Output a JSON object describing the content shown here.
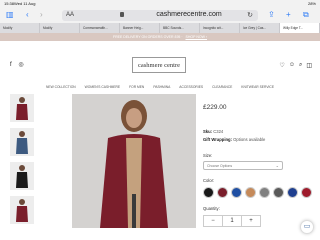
{
  "status_bar": {
    "time": "15:38",
    "date": "Wed 11 Aug",
    "battery": "28%"
  },
  "browser": {
    "aa_label": "AA",
    "url": "cashmerecentre.com",
    "tabs": [
      {
        "label": "Modify"
      },
      {
        "label": "Modify"
      },
      {
        "label": "Commonwealth..."
      },
      {
        "label": "Banner Heig..."
      },
      {
        "label": "BBC Sounds..."
      },
      {
        "label": "Incognito wit..."
      },
      {
        "label": "Ice Grey | Cas..."
      },
      {
        "label": "Willy Edge T..."
      }
    ]
  },
  "promo": {
    "text": "FREE DELIVERY ON ORDERS OVER £95 ·",
    "link": "SHOP NOW ›"
  },
  "header": {
    "logo": "cashmere centre"
  },
  "nav": [
    "NEW COLLECTION",
    "WOMEN'S CASHMERE",
    "FOR MEN",
    "PASHMINA",
    "ACCESSORIES",
    "CLEARANCE",
    "KNITWEAR SERVICE"
  ],
  "product": {
    "price": "£229.00",
    "sku_label": "Sku:",
    "sku_value": "C324",
    "gift_label": "Gift Wrapping:",
    "gift_value": "Options available",
    "size_label": "Size:",
    "size_placeholder": "Choose Options",
    "color_label": "Color:",
    "swatches": [
      "#1a1a1a",
      "#7a1e2b",
      "#1f4fa3",
      "#c58a5a",
      "#808080",
      "#5a5a5a",
      "#1f3f8f",
      "#9e1b2c"
    ],
    "quantity_label": "Quantity:",
    "qty_minus": "−",
    "qty_value": "1",
    "qty_plus": "+"
  },
  "colors": {
    "accent": "#2f7cf6",
    "promo_bg": "#d9c8c1",
    "product": "#7a1e2b"
  }
}
